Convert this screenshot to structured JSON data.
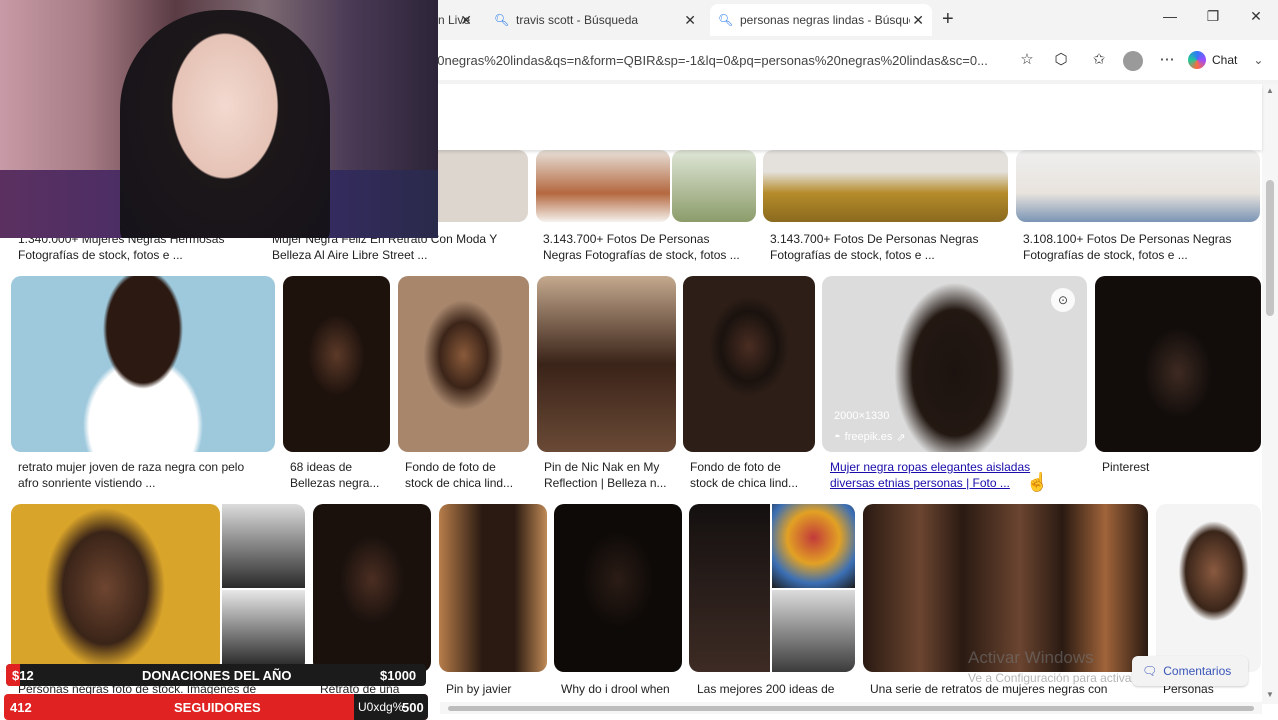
{
  "tabs": [
    {
      "label": "n Live",
      "icon": "edge-icon"
    },
    {
      "label": "travis scott - Búsqueda",
      "icon": "search-icon"
    },
    {
      "label": "personas negras lindas - Búsqueda",
      "icon": "search-icon"
    }
  ],
  "address_bar": {
    "url": "20negras%20lindas&qs=n&form=QBIR&sp=-1&lq=0&pq=personas%20negras%20lindas&sc=0..."
  },
  "toolbar": {
    "chat_label": "Chat"
  },
  "row1_captions": [
    {
      "line1": "1.340.000+ Mujeres Negras Hermosas",
      "line2": "Fotografías de stock, fotos e ..."
    },
    {
      "line1": "Mujer Negra Feliz En Retrato Con Moda Y",
      "line2": "Belleza Al Aire Libre Street ..."
    },
    {
      "line1": "3.143.700+ Fotos De Personas",
      "line2": "Negras Fotografías de stock, fotos ..."
    },
    {
      "line1": "3.143.700+ Fotos De Personas Negras",
      "line2": "Fotografías de stock, fotos e ..."
    },
    {
      "line1": "3.108.100+ Fotos De Personas Negras",
      "line2": "Fotografías de stock, fotos e ..."
    }
  ],
  "row2_captions": [
    {
      "line1": "retrato mujer joven de raza negra con pelo",
      "line2": "afro sonriente vistiendo ..."
    },
    {
      "line1": "68 ideas de",
      "line2": "Bellezas negra..."
    },
    {
      "line1": "Fondo de foto de",
      "line2": "stock de chica lind..."
    },
    {
      "line1": "Pin de Nic Nak en My",
      "line2": "Reflection | Belleza n..."
    },
    {
      "line1": "Fondo de foto de",
      "line2": "stock de chica lind..."
    },
    {
      "line1": "Mujer negra ropas elegantes aisladas",
      "line2": "diversas etnias personas | Foto ..."
    },
    {
      "line1": "Pinterest",
      "line2": ""
    }
  ],
  "hover_image": {
    "dimensions": "2000×1330",
    "source": "freepik.es"
  },
  "row3_captions": [
    {
      "line1": "Personas negras foto de stock. Imágenes de"
    },
    {
      "line1": "Retrato de una"
    },
    {
      "line1": "Pin by javier"
    },
    {
      "line1": "Why do i drool when"
    },
    {
      "line1": "Las mejores 200 ideas de"
    },
    {
      "line1": "Una serie de retratos de mujeres negras con"
    },
    {
      "line1": "Personas"
    }
  ],
  "overlay": {
    "donations_left": "$12",
    "donations_title": "DONACIONES DEL AÑO",
    "donations_right": "$1000",
    "followers_count": "412",
    "followers_title": "SEGUIDORES",
    "followers_code": "U0xdg%",
    "followers_goal": "500"
  },
  "watermark": {
    "title": "Activar Windows",
    "subtitle": "Ve a Configuración para activar Windows."
  },
  "feedback_label": "Comentarios"
}
